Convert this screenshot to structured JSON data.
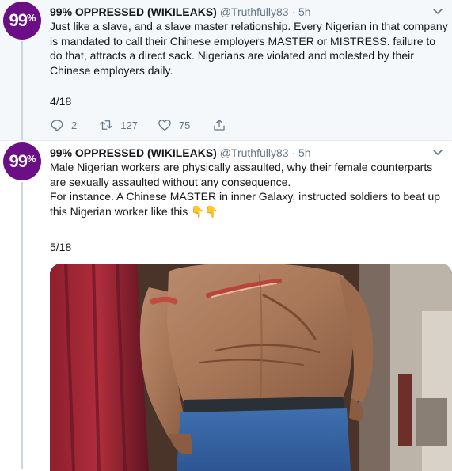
{
  "account": {
    "avatar_text": "99",
    "avatar_suffix": "%",
    "display_name": "99% OPPRESSED (WIKILEAKS)",
    "handle": "@Truthfully83",
    "separator": "·",
    "avatar_color": "#6c0f87"
  },
  "tweets": [
    {
      "time": "5h",
      "text": "Just like a slave, and a slave master relationship. Every Nigerian in that company is mandated to call their Chinese employers MASTER or MISTRESS. failure to do that, attracts a direct sack. Nigerians are violated and molested by their Chinese employers daily.",
      "counter": "4/18",
      "replies": "2",
      "retweets": "127",
      "likes": "75"
    },
    {
      "time": "5h",
      "text_line1": "Male Nigerian workers are physically assaulted, why their female counterparts are sexually assaulted without any consequence.",
      "text_line2": "For instance. A Chinese MASTER in inner Galaxy, instructed soldiers to beat up this Nigerian worker like this",
      "emoji": "👇👇",
      "counter": "5/18",
      "image_alt": "Photo of a shirtless man's back showing wounds and welts"
    }
  ],
  "colors": {
    "thread_bg": "#f5f8fa",
    "text": "#14171a",
    "muted": "#657786"
  },
  "icons": [
    "reply-icon",
    "retweet-icon",
    "like-icon",
    "share-icon",
    "chevron-down-icon"
  ]
}
